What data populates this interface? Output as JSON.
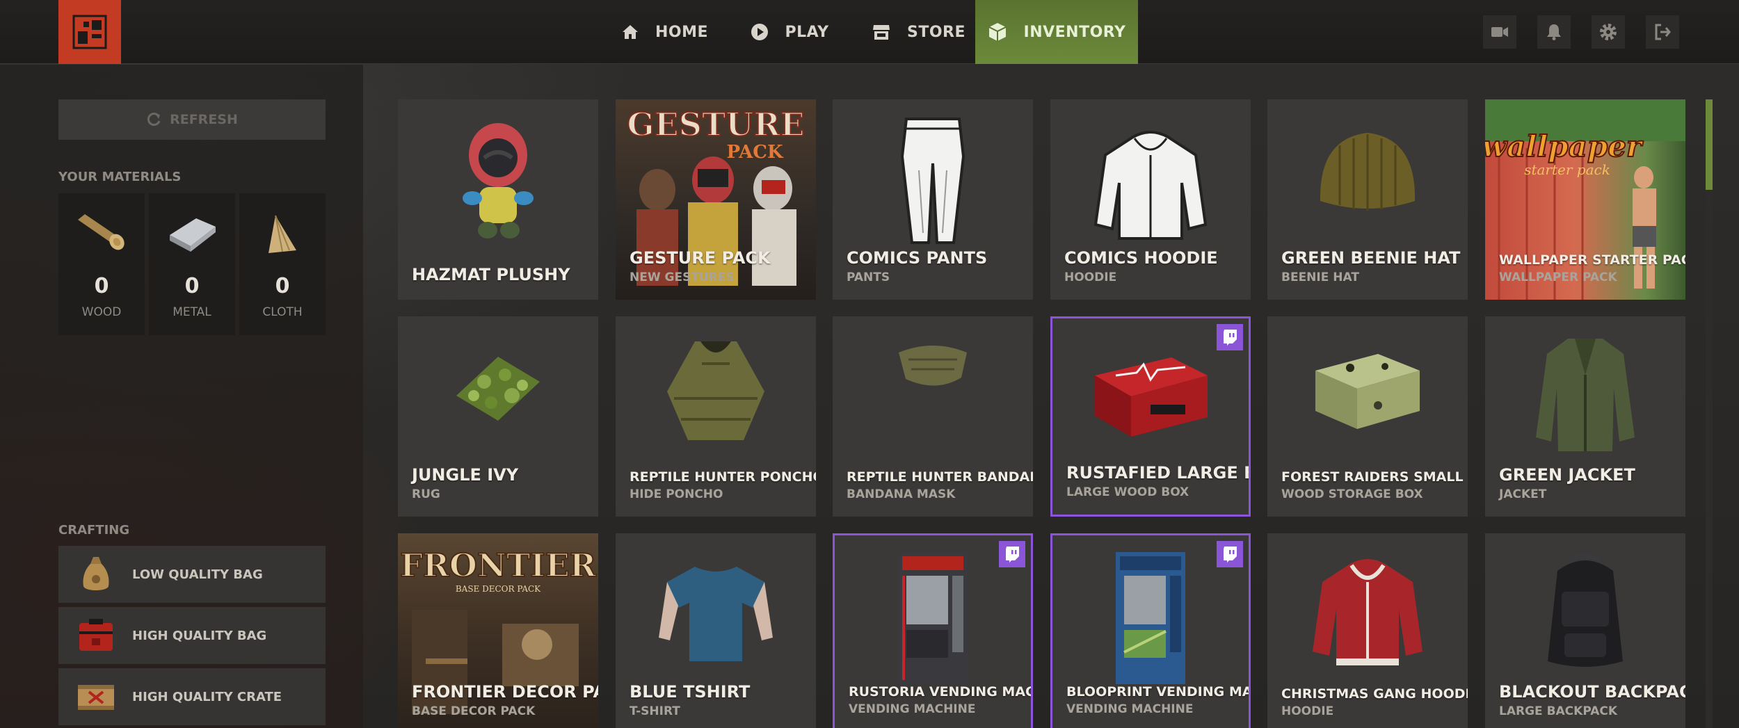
{
  "nav": {
    "home": "HOME",
    "play": "PLAY",
    "store": "STORE",
    "inventory": "INVENTORY"
  },
  "sidebar": {
    "refresh_label": "REFRESH",
    "materials_heading": "YOUR MATERIALS",
    "materials": [
      {
        "name": "WOOD",
        "count": "0"
      },
      {
        "name": "METAL",
        "count": "0"
      },
      {
        "name": "CLOTH",
        "count": "0"
      }
    ],
    "crafting_heading": "CRAFTING",
    "crafting": [
      {
        "label": "LOW QUALITY BAG"
      },
      {
        "label": "HIGH QUALITY BAG"
      },
      {
        "label": "HIGH QUALITY CRATE"
      }
    ]
  },
  "items": [
    {
      "name": "HAZMAT PLUSHY",
      "sub": ""
    },
    {
      "name": "GESTURE PACK",
      "sub": "NEW GESTURES"
    },
    {
      "name": "COMICS PANTS",
      "sub": "PANTS"
    },
    {
      "name": "COMICS HOODIE",
      "sub": "HOODIE"
    },
    {
      "name": "GREEN BEENIE HAT",
      "sub": "BEENIE HAT"
    },
    {
      "name": "WALLPAPER STARTER PACK",
      "sub": "WALLPAPER PACK"
    },
    {
      "name": "JUNGLE IVY",
      "sub": "RUG"
    },
    {
      "name": "REPTILE HUNTER PONCHO",
      "sub": "HIDE PONCHO"
    },
    {
      "name": "REPTILE HUNTER BANDANA",
      "sub": "BANDANA MASK"
    },
    {
      "name": "RUSTAFIED LARGE BOX",
      "sub": "LARGE WOOD BOX"
    },
    {
      "name": "FOREST RAIDERS SMALL BOX",
      "sub": "WOOD STORAGE BOX"
    },
    {
      "name": "GREEN JACKET",
      "sub": "JACKET"
    },
    {
      "name": "FRONTIER DECOR PACK",
      "sub": "BASE DECOR PACK"
    },
    {
      "name": "BLUE TSHIRT",
      "sub": "T-SHIRT"
    },
    {
      "name": "RUSTORIA VENDING MACHINE",
      "sub": "VENDING MACHINE"
    },
    {
      "name": "BLOOPRINT VENDING MACHINE",
      "sub": "VENDING MACHINE"
    },
    {
      "name": "CHRISTMAS GANG HOODIE",
      "sub": "HOODIE"
    },
    {
      "name": "BLACKOUT BACKPACK",
      "sub": "LARGE BACKPACK"
    }
  ],
  "art_text": {
    "gesture_title": "GESTURE",
    "gesture_pack": "PACK",
    "wallpaper_title": "wallpaper",
    "wallpaper_sub": "starter pack",
    "frontier_title": "FRONTIER",
    "frontier_sub": "BASE DECOR PACK"
  },
  "colors": {
    "accent_green": "#6c8a3a",
    "brand_red": "#c23b22",
    "twitch_purple": "#8a55d6"
  },
  "icons": [
    "rust-logo-icon",
    "home-icon",
    "play-icon",
    "store-icon",
    "inventory-box-icon",
    "camera-icon",
    "bell-icon",
    "gear-icon",
    "logout-icon",
    "refresh-icon",
    "twitch-icon"
  ]
}
